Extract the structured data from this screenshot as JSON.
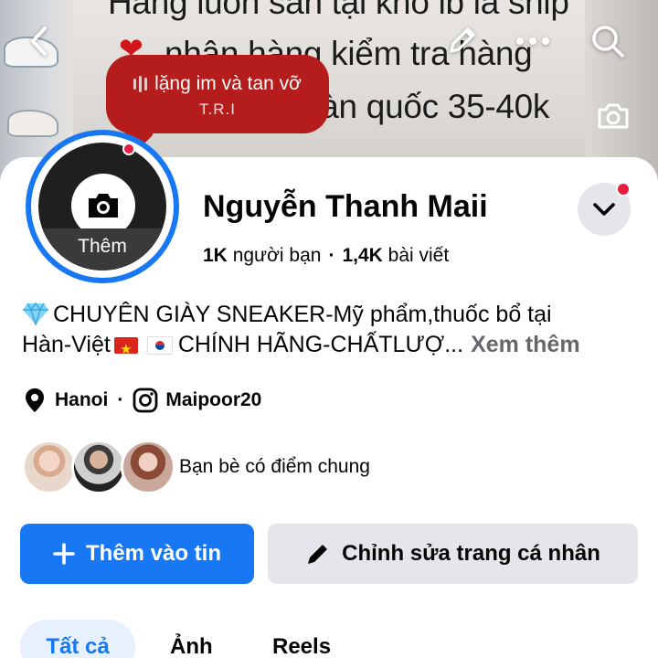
{
  "cover": {
    "line1": "Hàng luôn sẵn tại kho ib là ship",
    "line2": "nhận hàng kiểm tra hàng",
    "line3": "toàn quốc 35-40k",
    "heart1": "❤",
    "heart2": "❤"
  },
  "music": {
    "title": "lặng im và tan vỡ",
    "artist": "T.R.I"
  },
  "profile": {
    "avatar_label": "Thêm",
    "name": "Nguyễn Thanh Maii",
    "friends_count": "1K",
    "friends_label": "người bạn",
    "dot": "·",
    "posts_count": "1,4K",
    "posts_label": "bài viết"
  },
  "bio": {
    "line1": "CHUYÊN GIÀY SNEAKER-Mỹ phẩm,thuốc bổ tại",
    "line2a": "Hàn-Việt",
    "line2b": "CHÍNH HÃNG-CHẤTLƯỢ...",
    "see_more": "Xem thêm"
  },
  "details": {
    "location": "Hanoi",
    "separator": "·",
    "instagram": "Maipoor20"
  },
  "mutual": {
    "label": "Bạn bè có điểm chung"
  },
  "actions": {
    "add_story": "Thêm vào tin",
    "add_story_icon": "+",
    "edit_profile": "Chỉnh sửa trang cá nhân"
  },
  "tabs": [
    {
      "label": "Tất cả"
    },
    {
      "label": "Ảnh"
    },
    {
      "label": "Reels"
    }
  ],
  "colors": {
    "accent": "#1877f2",
    "badge": "#e41e3f",
    "music_bubble": "#b51c1c",
    "secondary_button": "#e4e6eb"
  }
}
